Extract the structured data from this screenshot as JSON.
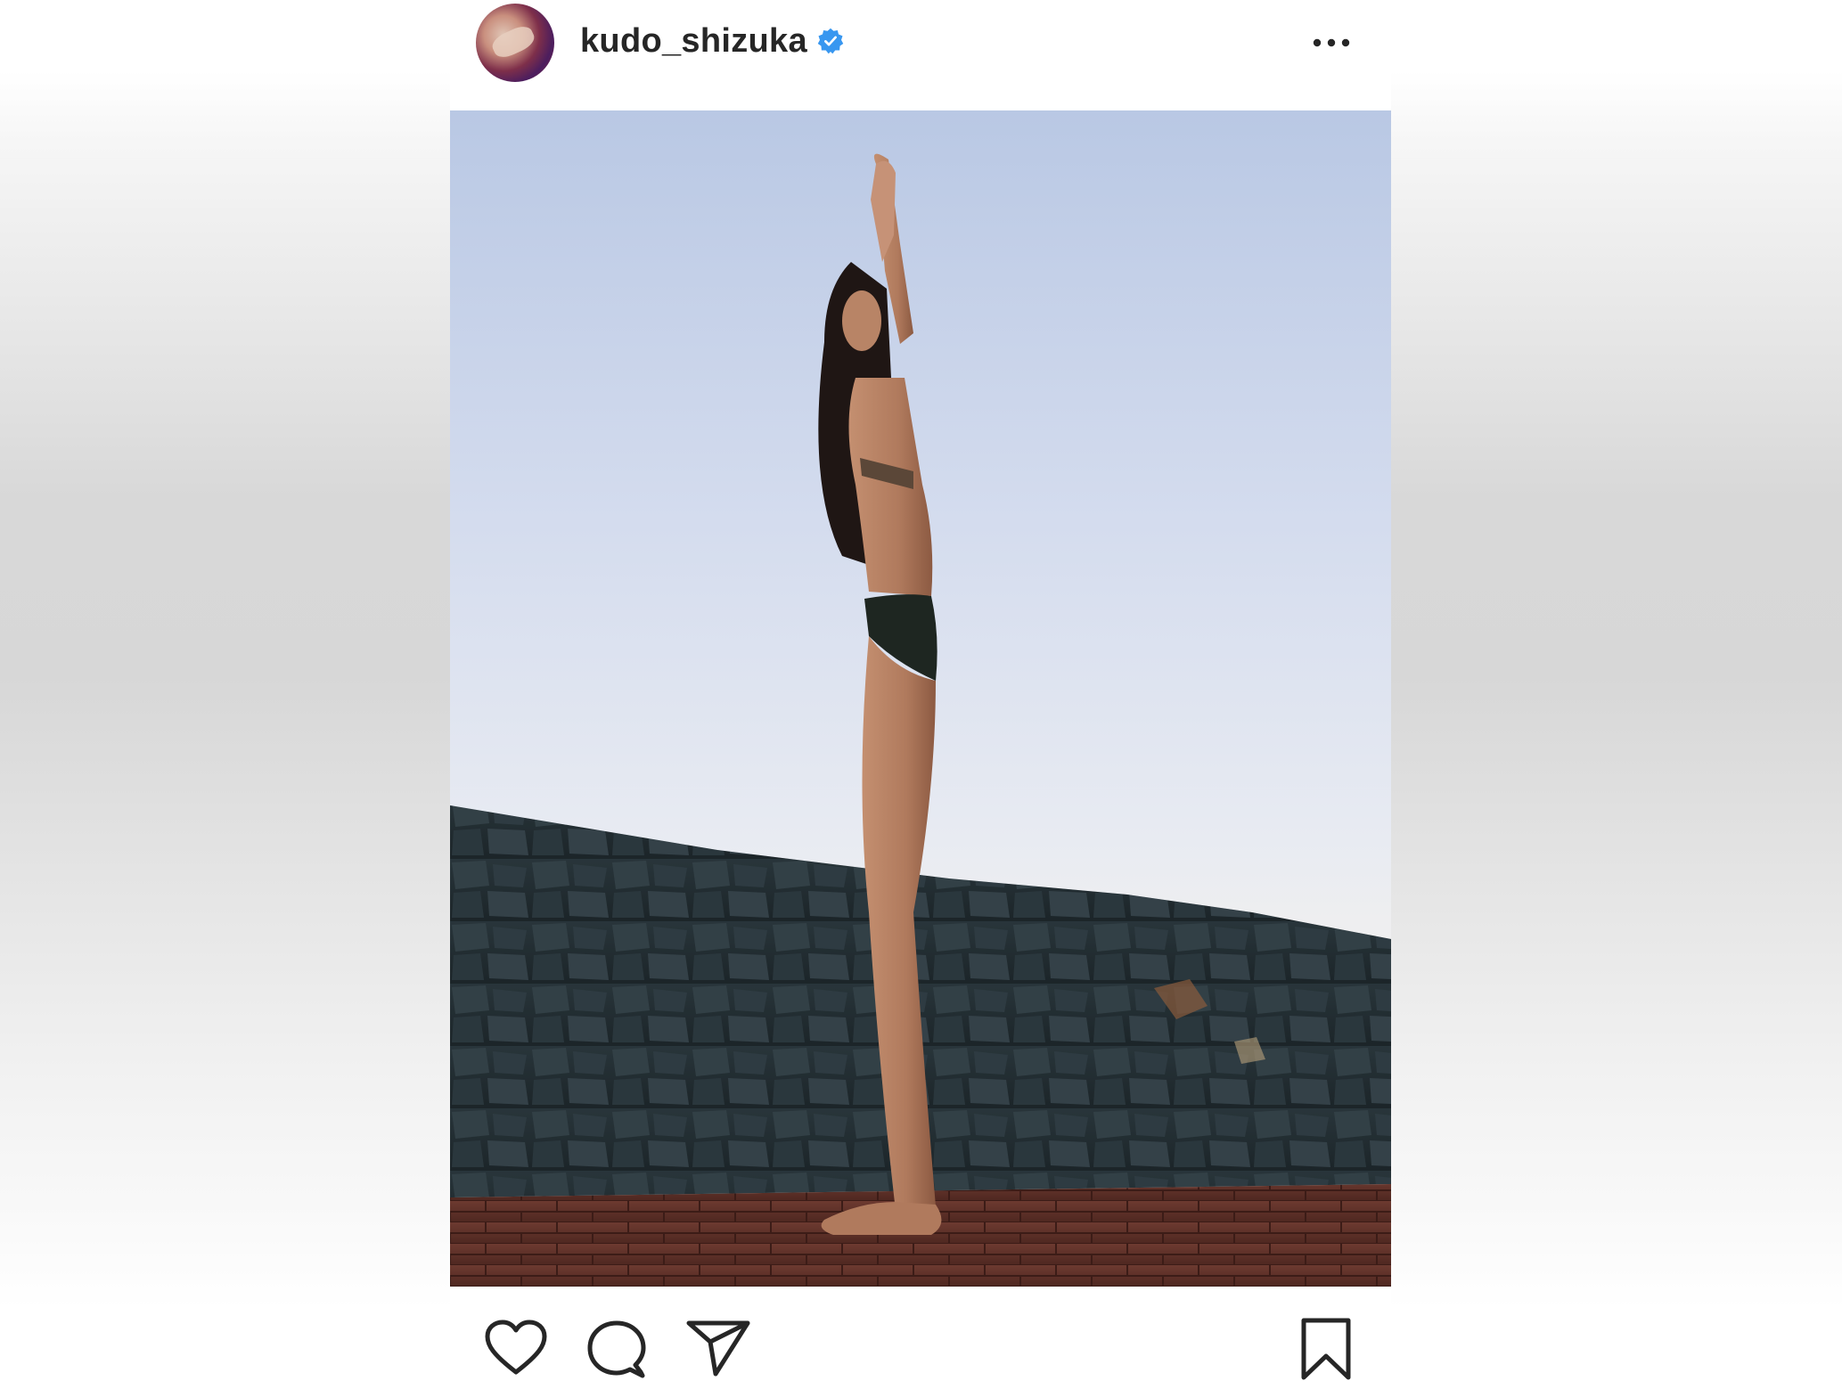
{
  "post": {
    "username": "kudo_shizuka",
    "verified": true,
    "avatar_icon": "profile-avatar",
    "more_icon": "ellipsis-icon",
    "photo_description_icon": "post-photo"
  },
  "actions": {
    "like_icon": "heart-icon",
    "comment_icon": "comment-icon",
    "share_icon": "paper-plane-icon",
    "save_icon": "bookmark-icon"
  },
  "colors": {
    "text": "#262626",
    "verified_badge": "#3897f0",
    "icon_stroke": "#262626"
  }
}
